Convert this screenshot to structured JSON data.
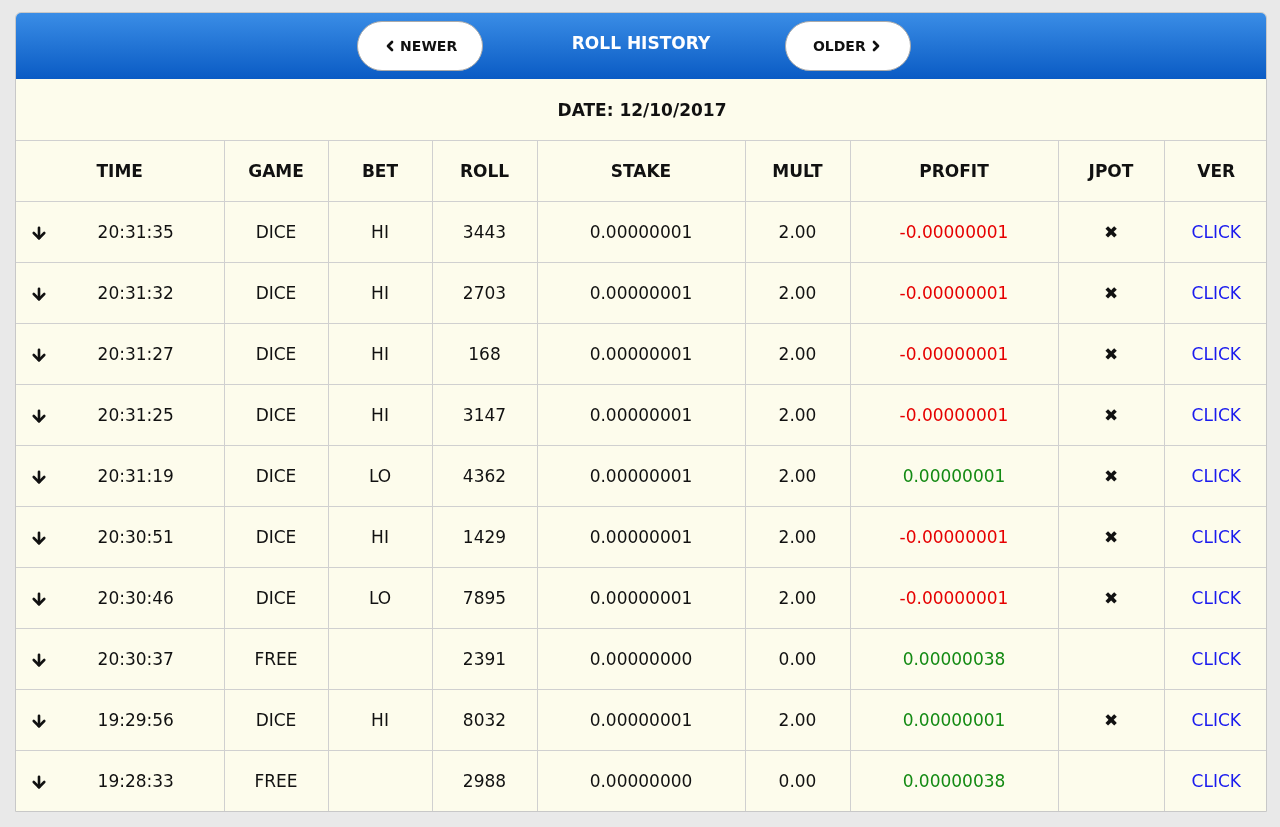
{
  "header": {
    "title": "ROLL HISTORY",
    "newer_button": "NEWER",
    "older_button": "OLDER"
  },
  "date": "DATE: 12/10/2017",
  "columns": [
    "TIME",
    "GAME",
    "BET",
    "ROLL",
    "STAKE",
    "MULT",
    "PROFIT",
    "JPOT",
    "VER"
  ],
  "rows": [
    {
      "time": "20:31:35",
      "game": "DICE",
      "bet": "HI",
      "roll": "3443",
      "stake": "0.00000001",
      "mult": "2.00",
      "profit": "-0.00000001",
      "color": "#e60000",
      "jpot": "✖",
      "ver": "CLICK"
    },
    {
      "time": "20:31:32",
      "game": "DICE",
      "bet": "HI",
      "roll": "2703",
      "stake": "0.00000001",
      "mult": "2.00",
      "profit": "-0.00000001",
      "color": "#e60000",
      "jpot": "✖",
      "ver": "CLICK"
    },
    {
      "time": "20:31:27",
      "game": "DICE",
      "bet": "HI",
      "roll": "168",
      "stake": "0.00000001",
      "mult": "2.00",
      "profit": "-0.00000001",
      "color": "#e60000",
      "jpot": "✖",
      "ver": "CLICK"
    },
    {
      "time": "20:31:25",
      "game": "DICE",
      "bet": "HI",
      "roll": "3147",
      "stake": "0.00000001",
      "mult": "2.00",
      "profit": "-0.00000001",
      "color": "#e60000",
      "jpot": "✖",
      "ver": "CLICK"
    },
    {
      "time": "20:31:19",
      "game": "DICE",
      "bet": "LO",
      "roll": "4362",
      "stake": "0.00000001",
      "mult": "2.00",
      "profit": "0.00000001",
      "color": "#138a13",
      "jpot": "✖",
      "ver": "CLICK"
    },
    {
      "time": "20:30:51",
      "game": "DICE",
      "bet": "HI",
      "roll": "1429",
      "stake": "0.00000001",
      "mult": "2.00",
      "profit": "-0.00000001",
      "color": "#e60000",
      "jpot": "✖",
      "ver": "CLICK"
    },
    {
      "time": "20:30:46",
      "game": "DICE",
      "bet": "LO",
      "roll": "7895",
      "stake": "0.00000001",
      "mult": "2.00",
      "profit": "-0.00000001",
      "color": "#e60000",
      "jpot": "✖",
      "ver": "CLICK"
    },
    {
      "time": "20:30:37",
      "game": "FREE",
      "roll": "2391",
      "stake": "0.00000000",
      "mult": "0.00",
      "profit": "0.00000038",
      "color": "#138a13",
      "ver": "CLICK"
    },
    {
      "time": "19:29:56",
      "game": "DICE",
      "bet": "HI",
      "roll": "8032",
      "stake": "0.00000001",
      "mult": "2.00",
      "profit": "0.00000001",
      "color": "#138a13",
      "jpot": "✖",
      "ver": "CLICK"
    },
    {
      "time": "19:28:33",
      "game": "FREE",
      "roll": "2988",
      "stake": "0.00000000",
      "mult": "0.00",
      "profit": "0.00000038",
      "color": "#138a13",
      "ver": "CLICK"
    }
  ]
}
